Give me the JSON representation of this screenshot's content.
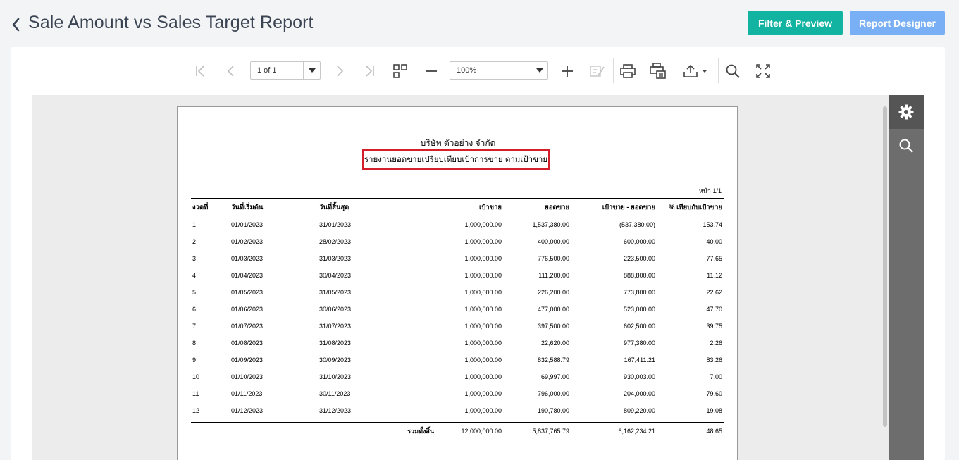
{
  "header": {
    "title": "Sale Amount vs Sales Target Report",
    "filter_label": "Filter & Preview",
    "designer_label": "Report Designer"
  },
  "toolbar": {
    "page_value": "1 of 1",
    "zoom_value": "100%",
    "icons": [
      "first-page-icon",
      "prev-page-icon",
      "next-page-icon",
      "last-page-icon",
      "multipage-icon",
      "zoom-out-icon",
      "zoom-in-icon",
      "edit-fields-icon",
      "print-icon",
      "print-page-icon",
      "export-icon",
      "search-icon",
      "fullscreen-icon"
    ]
  },
  "side_panel": {
    "icons": [
      "gear-icon",
      "search-icon"
    ]
  },
  "report": {
    "company": "บริษัท ตัวอย่าง จำกัด",
    "title": "รายงานยอดขายเปรียบเทียบเป้าการขาย ตามเป้าขาย",
    "page_no": "หน้า 1/1",
    "columns": {
      "period": "งวดที่",
      "start": "วันที่เริ่มต้น",
      "end": "วันที่สิ้นสุด",
      "target": "เป้าขาย",
      "sales": "ยอดขาย",
      "diff": "เป้าขาย - ยอดขาย",
      "pct": "% เทียบกับเป้าขาย"
    },
    "rows": [
      {
        "period": "1",
        "start": "01/01/2023",
        "end": "31/01/2023",
        "target": "1,000,000.00",
        "sales": "1,537,380.00",
        "diff": "(537,380.00)",
        "pct": "153.74"
      },
      {
        "period": "2",
        "start": "01/02/2023",
        "end": "28/02/2023",
        "target": "1,000,000.00",
        "sales": "400,000.00",
        "diff": "600,000.00",
        "pct": "40.00"
      },
      {
        "period": "3",
        "start": "01/03/2023",
        "end": "31/03/2023",
        "target": "1,000,000.00",
        "sales": "776,500.00",
        "diff": "223,500.00",
        "pct": "77.65"
      },
      {
        "period": "4",
        "start": "01/04/2023",
        "end": "30/04/2023",
        "target": "1,000,000.00",
        "sales": "111,200.00",
        "diff": "888,800.00",
        "pct": "11.12"
      },
      {
        "period": "5",
        "start": "01/05/2023",
        "end": "31/05/2023",
        "target": "1,000,000.00",
        "sales": "226,200.00",
        "diff": "773,800.00",
        "pct": "22.62"
      },
      {
        "period": "6",
        "start": "01/06/2023",
        "end": "30/06/2023",
        "target": "1,000,000.00",
        "sales": "477,000.00",
        "diff": "523,000.00",
        "pct": "47.70"
      },
      {
        "period": "7",
        "start": "01/07/2023",
        "end": "31/07/2023",
        "target": "1,000,000.00",
        "sales": "397,500.00",
        "diff": "602,500.00",
        "pct": "39.75"
      },
      {
        "period": "8",
        "start": "01/08/2023",
        "end": "31/08/2023",
        "target": "1,000,000.00",
        "sales": "22,620.00",
        "diff": "977,380.00",
        "pct": "2.26"
      },
      {
        "period": "9",
        "start": "01/09/2023",
        "end": "30/09/2023",
        "target": "1,000,000.00",
        "sales": "832,588.79",
        "diff": "167,411.21",
        "pct": "83.26"
      },
      {
        "period": "10",
        "start": "01/10/2023",
        "end": "31/10/2023",
        "target": "1,000,000.00",
        "sales": "69,997.00",
        "diff": "930,003.00",
        "pct": "7.00"
      },
      {
        "period": "11",
        "start": "01/11/2023",
        "end": "30/11/2023",
        "target": "1,000,000.00",
        "sales": "796,000.00",
        "diff": "204,000.00",
        "pct": "79.60"
      },
      {
        "period": "12",
        "start": "01/12/2023",
        "end": "31/12/2023",
        "target": "1,000,000.00",
        "sales": "190,780.00",
        "diff": "809,220.00",
        "pct": "19.08"
      }
    ],
    "total": {
      "label": "รวมทั้งสิ้น",
      "target": "12,000,000.00",
      "sales": "5,837,765.79",
      "diff": "6,162,234.21",
      "pct": "48.65"
    }
  },
  "colors": {
    "filter_button": "#13b3a2",
    "designer_button": "#78aff5",
    "title_box_border": "#d21f2b",
    "side_panel": "#6d6d6d"
  }
}
